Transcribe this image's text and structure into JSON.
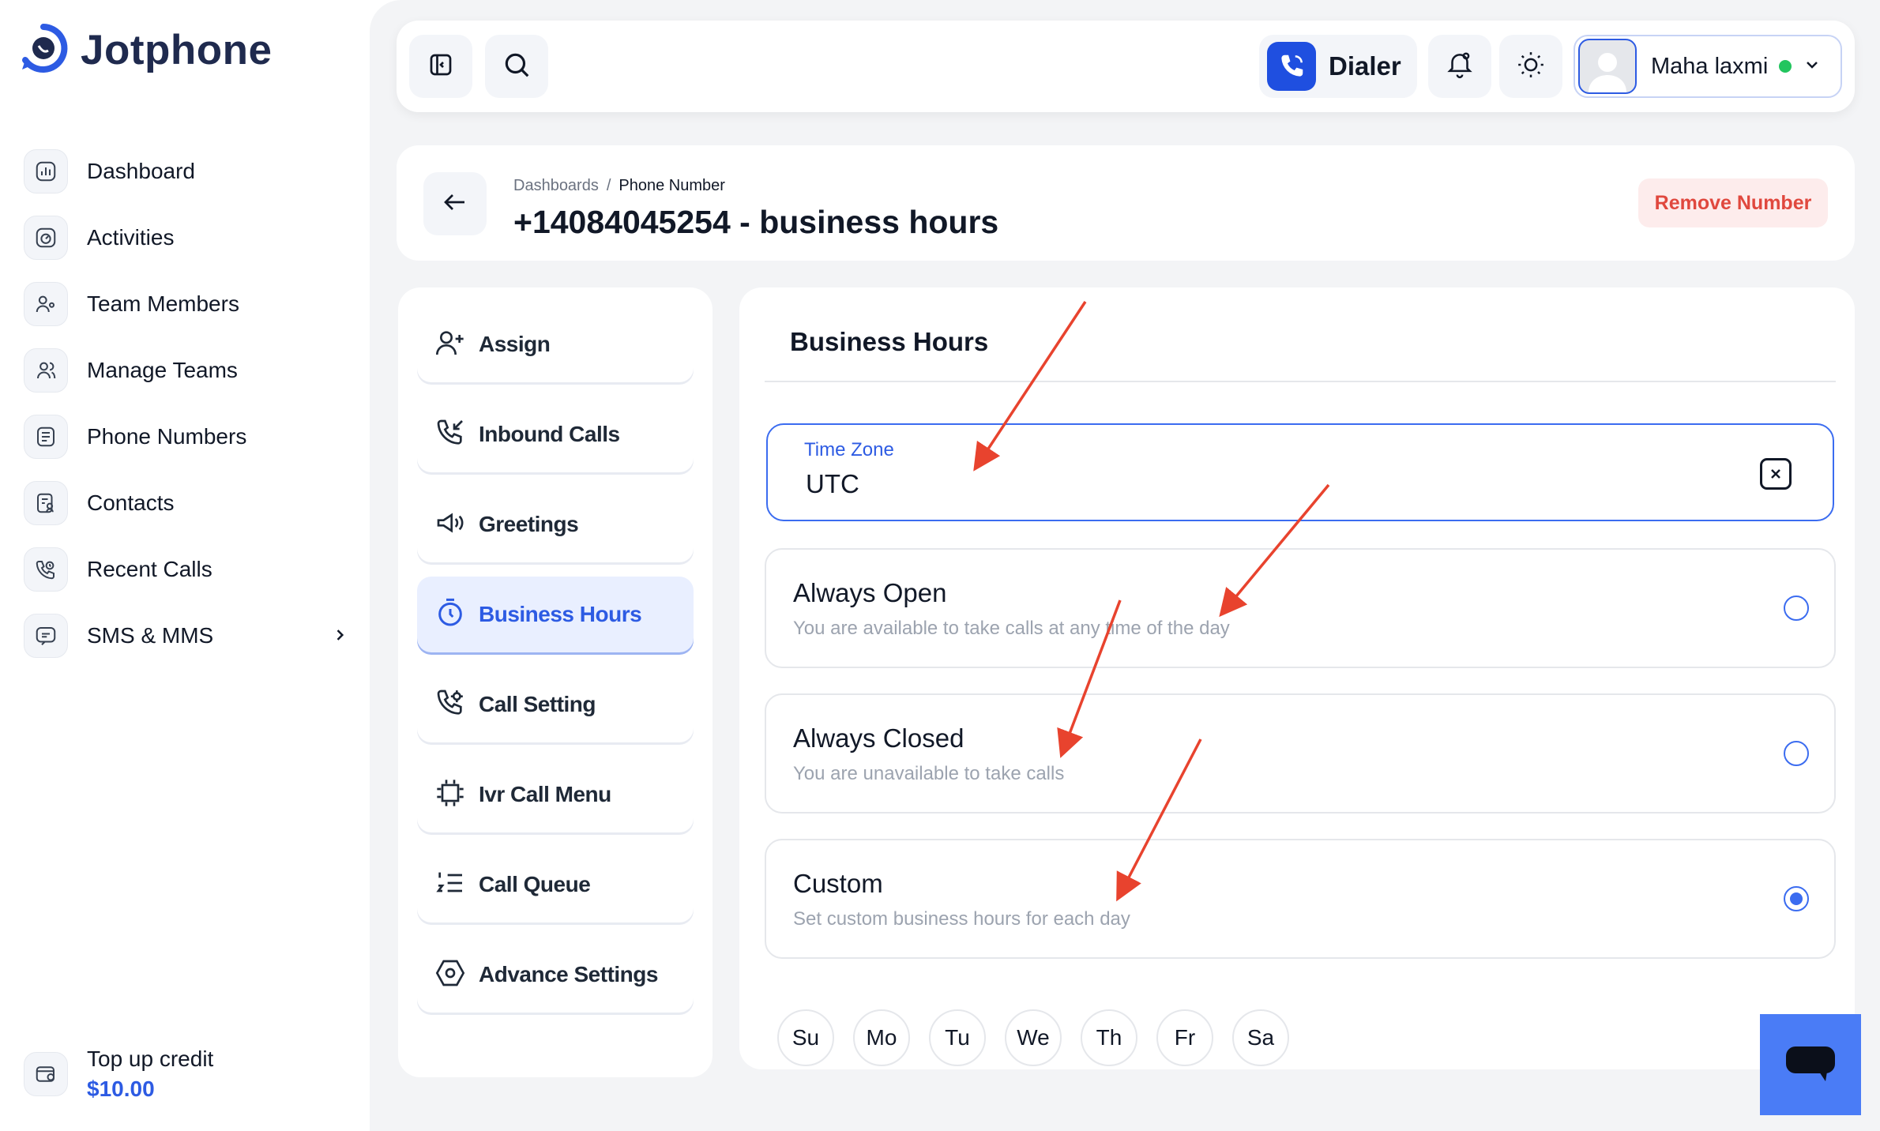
{
  "app": {
    "name": "Jotphone"
  },
  "sidebar": {
    "items": [
      {
        "label": "Dashboard",
        "icon": "dashboard-icon"
      },
      {
        "label": "Activities",
        "icon": "activities-icon"
      },
      {
        "label": "Team Members",
        "icon": "team-members-icon"
      },
      {
        "label": "Manage Teams",
        "icon": "manage-teams-icon"
      },
      {
        "label": "Phone Numbers",
        "icon": "phone-numbers-icon"
      },
      {
        "label": "Contacts",
        "icon": "contacts-icon"
      },
      {
        "label": "Recent Calls",
        "icon": "recent-calls-icon"
      },
      {
        "label": "SMS & MMS",
        "icon": "sms-icon",
        "has_chevron": true
      }
    ],
    "topup": {
      "title": "Top up credit",
      "amount": "$10.00"
    }
  },
  "topbar": {
    "dialer_label": "Dialer",
    "user": {
      "name": "Maha laxmi",
      "status": "online",
      "status_color": "#22c55e"
    }
  },
  "header": {
    "breadcrumb": [
      "Dashboards",
      "Phone Number"
    ],
    "breadcrumb_sep": "/",
    "title": "+14084045254 - business hours",
    "remove_button": "Remove Number"
  },
  "settings_menu": {
    "items": [
      {
        "label": "Assign",
        "icon": "assign-user-icon"
      },
      {
        "label": "Inbound Calls",
        "icon": "inbound-call-icon"
      },
      {
        "label": "Greetings",
        "icon": "megaphone-icon"
      },
      {
        "label": "Business Hours",
        "icon": "timer-icon",
        "active": true
      },
      {
        "label": "Call Setting",
        "icon": "call-settings-icon"
      },
      {
        "label": "Ivr Call Menu",
        "icon": "ivr-menu-icon"
      },
      {
        "label": "Call Queue",
        "icon": "numbered-list-icon"
      },
      {
        "label": "Advance Settings",
        "icon": "hexagon-settings-icon"
      }
    ]
  },
  "business_hours": {
    "title": "Business Hours",
    "timezone": {
      "label": "Time Zone",
      "value": "UTC"
    },
    "options": [
      {
        "title": "Always Open",
        "description": "You are available to take calls at any time of the day",
        "selected": false
      },
      {
        "title": "Always Closed",
        "description": "You are unavailable to take calls",
        "selected": false
      },
      {
        "title": "Custom",
        "description": "Set custom business hours for each day",
        "selected": true
      }
    ],
    "days": [
      "Su",
      "Mo",
      "Tu",
      "We",
      "Th",
      "Fr",
      "Sa"
    ]
  },
  "colors": {
    "accent": "#2d5be3",
    "danger": "#e0483e",
    "annotation_arrow": "#e8432e",
    "chat_button": "#4a7cf6"
  }
}
